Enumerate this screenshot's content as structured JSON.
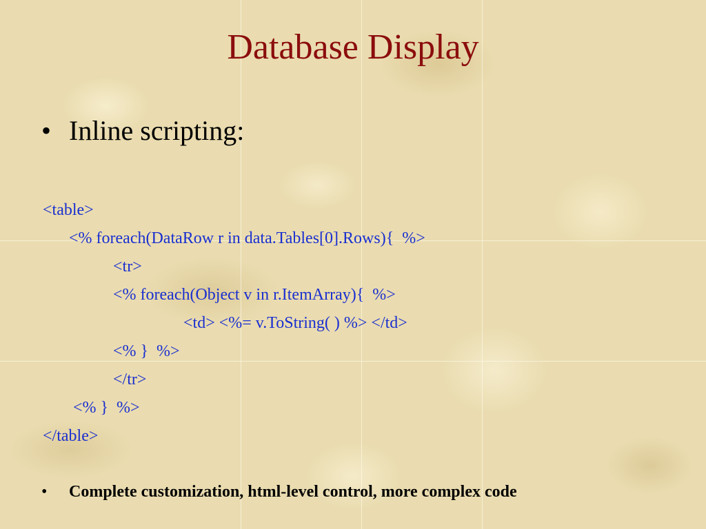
{
  "slide": {
    "title": "Database Display",
    "main_bullet": {
      "marker": "•",
      "text": "Inline scripting:"
    },
    "code_lines": [
      "<table>",
      "<% foreach(DataRow r in data.Tables[0].Rows){  %>",
      "<tr>",
      "<% foreach(Object v in r.ItemArray){  %>",
      "<td> <%= v.ToString( ) %> </td>",
      "<% }  %>",
      "</tr>",
      " <% }  %>",
      "</table>"
    ],
    "footer_bullet": {
      "marker": "•",
      "text": "Complete customization, html-level control, more complex code"
    }
  },
  "colors": {
    "background": "#eadcb0",
    "title": "#8b0d0d",
    "code": "#1a2fd0",
    "body_text": "#000000"
  }
}
